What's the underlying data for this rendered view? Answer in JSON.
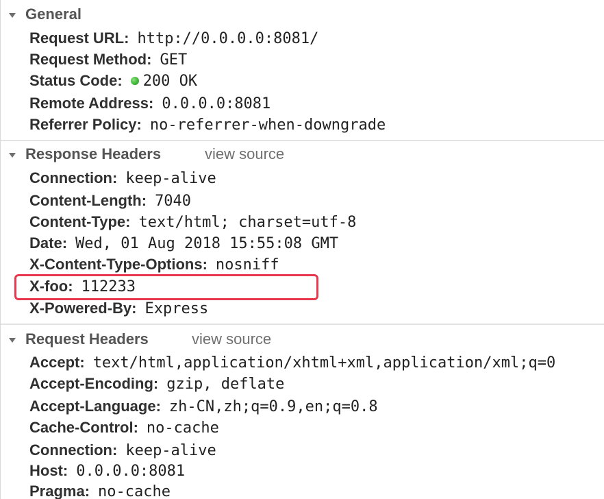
{
  "general": {
    "title": "General",
    "rows": [
      {
        "key": "Request URL",
        "value": "http://0.0.0.0:8081/"
      },
      {
        "key": "Request Method",
        "value": "GET"
      },
      {
        "key": "Status Code",
        "value": "200 OK"
      },
      {
        "key": "Remote Address",
        "value": "0.0.0.0:8081"
      },
      {
        "key": "Referrer Policy",
        "value": "no-referrer-when-downgrade"
      }
    ],
    "status_color": "#3fb83a"
  },
  "response_headers": {
    "title": "Response Headers",
    "view_source_label": "view source",
    "rows": [
      {
        "key": "Connection",
        "value": "keep-alive"
      },
      {
        "key": "Content-Length",
        "value": "7040"
      },
      {
        "key": "Content-Type",
        "value": "text/html; charset=utf-8"
      },
      {
        "key": "Date",
        "value": "Wed, 01 Aug 2018 15:55:08 GMT"
      },
      {
        "key": "X-Content-Type-Options",
        "value": "nosniff"
      },
      {
        "key": "X-foo",
        "value": "112233"
      },
      {
        "key": "X-Powered-By",
        "value": "Express"
      }
    ]
  },
  "request_headers": {
    "title": "Request Headers",
    "view_source_label": "view source",
    "rows": [
      {
        "key": "Accept",
        "value": "text/html,application/xhtml+xml,application/xml;q=0"
      },
      {
        "key": "Accept-Encoding",
        "value": "gzip, deflate"
      },
      {
        "key": "Accept-Language",
        "value": "zh-CN,zh;q=0.9,en;q=0.8"
      },
      {
        "key": "Cache-Control",
        "value": "no-cache"
      },
      {
        "key": "Connection",
        "value": "keep-alive"
      },
      {
        "key": "Host",
        "value": "0.0.0.0:8081"
      },
      {
        "key": "Pragma",
        "value": "no-cache"
      }
    ]
  },
  "highlight_color": "#e8384f"
}
